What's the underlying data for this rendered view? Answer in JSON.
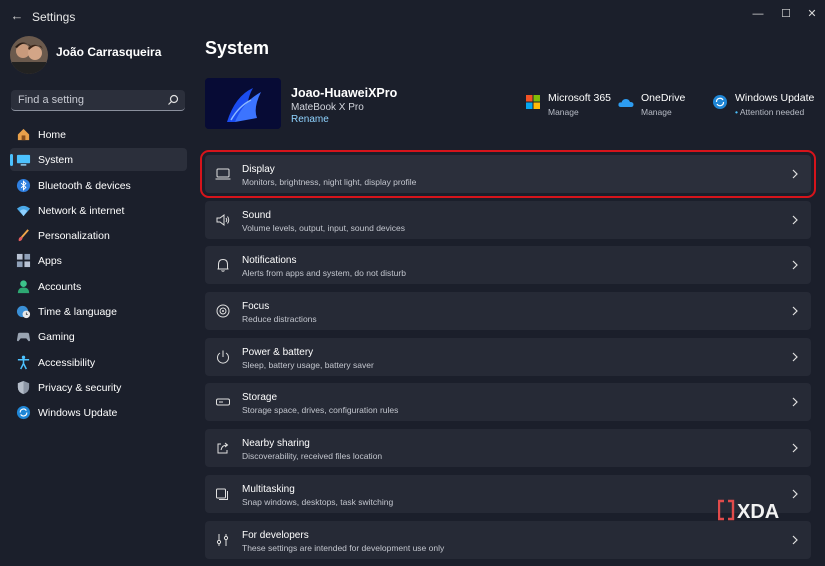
{
  "window": {
    "title": "Settings",
    "controls": {
      "minimize": "—",
      "maximize": "☐",
      "close": "✕"
    }
  },
  "profile": {
    "name": "João Carrasqueira"
  },
  "search": {
    "placeholder": "Find a setting"
  },
  "sidebar": {
    "items": [
      {
        "label": "Home",
        "icon": "home-icon",
        "selected": false
      },
      {
        "label": "System",
        "icon": "system-icon",
        "selected": true
      },
      {
        "label": "Bluetooth & devices",
        "icon": "bluetooth-icon",
        "selected": false
      },
      {
        "label": "Network & internet",
        "icon": "wifi-icon",
        "selected": false
      },
      {
        "label": "Personalization",
        "icon": "brush-icon",
        "selected": false
      },
      {
        "label": "Apps",
        "icon": "apps-icon",
        "selected": false
      },
      {
        "label": "Accounts",
        "icon": "accounts-icon",
        "selected": false
      },
      {
        "label": "Time & language",
        "icon": "globe-clock-icon",
        "selected": false
      },
      {
        "label": "Gaming",
        "icon": "gaming-icon",
        "selected": false
      },
      {
        "label": "Accessibility",
        "icon": "accessibility-icon",
        "selected": false
      },
      {
        "label": "Privacy & security",
        "icon": "shield-icon",
        "selected": false
      },
      {
        "label": "Windows Update",
        "icon": "update-icon",
        "selected": false
      }
    ]
  },
  "main": {
    "title": "System",
    "device": {
      "name": "Joao-HuaweiXPro",
      "model": "MateBook X Pro",
      "rename": "Rename"
    },
    "services": [
      {
        "name": "Microsoft 365",
        "sub": "Manage",
        "icon": "microsoft-365-icon"
      },
      {
        "name": "OneDrive",
        "sub": "Manage",
        "icon": "onedrive-icon"
      },
      {
        "name": "Windows Update",
        "sub": "Attention needed",
        "icon": "windows-update-icon"
      }
    ],
    "cards": [
      {
        "title": "Display",
        "sub": "Monitors, brightness, night light, display profile",
        "icon": "display-icon"
      },
      {
        "title": "Sound",
        "sub": "Volume levels, output, input, sound devices",
        "icon": "speaker-icon"
      },
      {
        "title": "Notifications",
        "sub": "Alerts from apps and system, do not disturb",
        "icon": "bell-icon"
      },
      {
        "title": "Focus",
        "sub": "Reduce distractions",
        "icon": "focus-icon"
      },
      {
        "title": "Power & battery",
        "sub": "Sleep, battery usage, battery saver",
        "icon": "power-icon"
      },
      {
        "title": "Storage",
        "sub": "Storage space, drives, configuration rules",
        "icon": "storage-icon"
      },
      {
        "title": "Nearby sharing",
        "sub": "Discoverability, received files location",
        "icon": "share-icon"
      },
      {
        "title": "Multitasking",
        "sub": "Snap windows, desktops, task switching",
        "icon": "multitasking-icon"
      },
      {
        "title": "For developers",
        "sub": "These settings are intended for development use only",
        "icon": "developer-icon"
      }
    ]
  },
  "watermark": {
    "text": "XDA"
  },
  "colors": {
    "accent": "#4cc2ff",
    "highlight_border": "#d6141b",
    "background": "#1b1f2b",
    "card": "#262a36"
  }
}
